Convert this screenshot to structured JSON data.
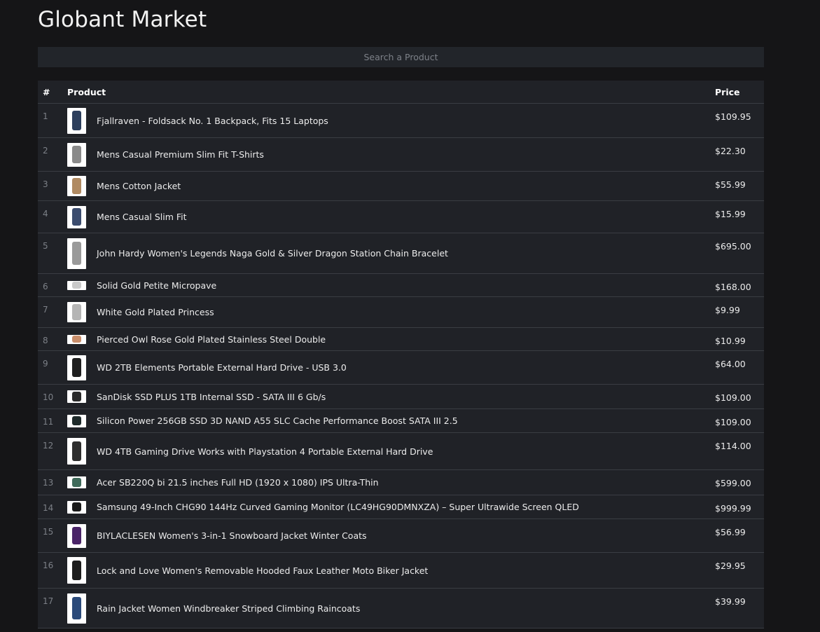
{
  "header": {
    "title": "Globant Market"
  },
  "search": {
    "placeholder": "Search a Product",
    "value": ""
  },
  "table": {
    "columns": {
      "num": "#",
      "product": "Product",
      "price": "Price"
    },
    "rows": [
      {
        "num": "1",
        "name": "Fjallraven - Foldsack No. 1 Backpack, Fits 15 Laptops",
        "price": "$109.95",
        "thumb_color": "#2c3e5c"
      },
      {
        "num": "2",
        "name": "Mens Casual Premium Slim Fit T-Shirts",
        "price": "$22.30",
        "thumb_color": "#8a8a8a"
      },
      {
        "num": "3",
        "name": "Mens Cotton Jacket",
        "price": "$55.99",
        "thumb_color": "#b08a62"
      },
      {
        "num": "4",
        "name": "Mens Casual Slim Fit",
        "price": "$15.99",
        "thumb_color": "#3b4c6e"
      },
      {
        "num": "5",
        "name": "John Hardy Women's Legends Naga Gold & Silver Dragon Station Chain Bracelet",
        "price": "$695.00",
        "thumb_color": "#9a9a9a"
      },
      {
        "num": "6",
        "name": "Solid Gold Petite Micropave",
        "price": "$168.00",
        "thumb_color": "#c9c9c9"
      },
      {
        "num": "7",
        "name": "White Gold Plated Princess",
        "price": "$9.99",
        "thumb_color": "#b5b5b5"
      },
      {
        "num": "8",
        "name": "Pierced Owl Rose Gold Plated Stainless Steel Double",
        "price": "$10.99",
        "thumb_color": "#c98e6b"
      },
      {
        "num": "9",
        "name": "WD 2TB Elements Portable External Hard Drive - USB 3.0",
        "price": "$64.00",
        "thumb_color": "#1f1f1f"
      },
      {
        "num": "10",
        "name": "SanDisk SSD PLUS 1TB Internal SSD - SATA III 6 Gb/s",
        "price": "$109.00",
        "thumb_color": "#2a2a2a"
      },
      {
        "num": "11",
        "name": "Silicon Power 256GB SSD 3D NAND A55 SLC Cache Performance Boost SATA III 2.5",
        "price": "$109.00",
        "thumb_color": "#1e2a2a"
      },
      {
        "num": "12",
        "name": "WD 4TB Gaming Drive Works with Playstation 4 Portable External Hard Drive",
        "price": "$114.00",
        "thumb_color": "#2e2e2e"
      },
      {
        "num": "13",
        "name": "Acer SB220Q bi 21.5 inches Full HD (1920 x 1080) IPS Ultra-Thin",
        "price": "$599.00",
        "thumb_color": "#3f6a5a"
      },
      {
        "num": "14",
        "name": "Samsung 49-Inch CHG90 144Hz Curved Gaming Monitor (LC49HG90DMNXZA) – Super Ultrawide Screen QLED",
        "price": "$999.99",
        "thumb_color": "#1a1a1a"
      },
      {
        "num": "15",
        "name": "BIYLACLESEN Women's 3-in-1 Snowboard Jacket Winter Coats",
        "price": "$56.99",
        "thumb_color": "#4a2468"
      },
      {
        "num": "16",
        "name": "Lock and Love Women's Removable Hooded Faux Leather Moto Biker Jacket",
        "price": "$29.95",
        "thumb_color": "#1c1c1c"
      },
      {
        "num": "17",
        "name": "Rain Jacket Women Windbreaker Striped Climbing Raincoats",
        "price": "$39.99",
        "thumb_color": "#2b4a7a"
      }
    ]
  },
  "theme": {
    "background": "#151517",
    "surface": "#202227",
    "search_bg": "#22252a",
    "divider": "#3a3d43"
  }
}
